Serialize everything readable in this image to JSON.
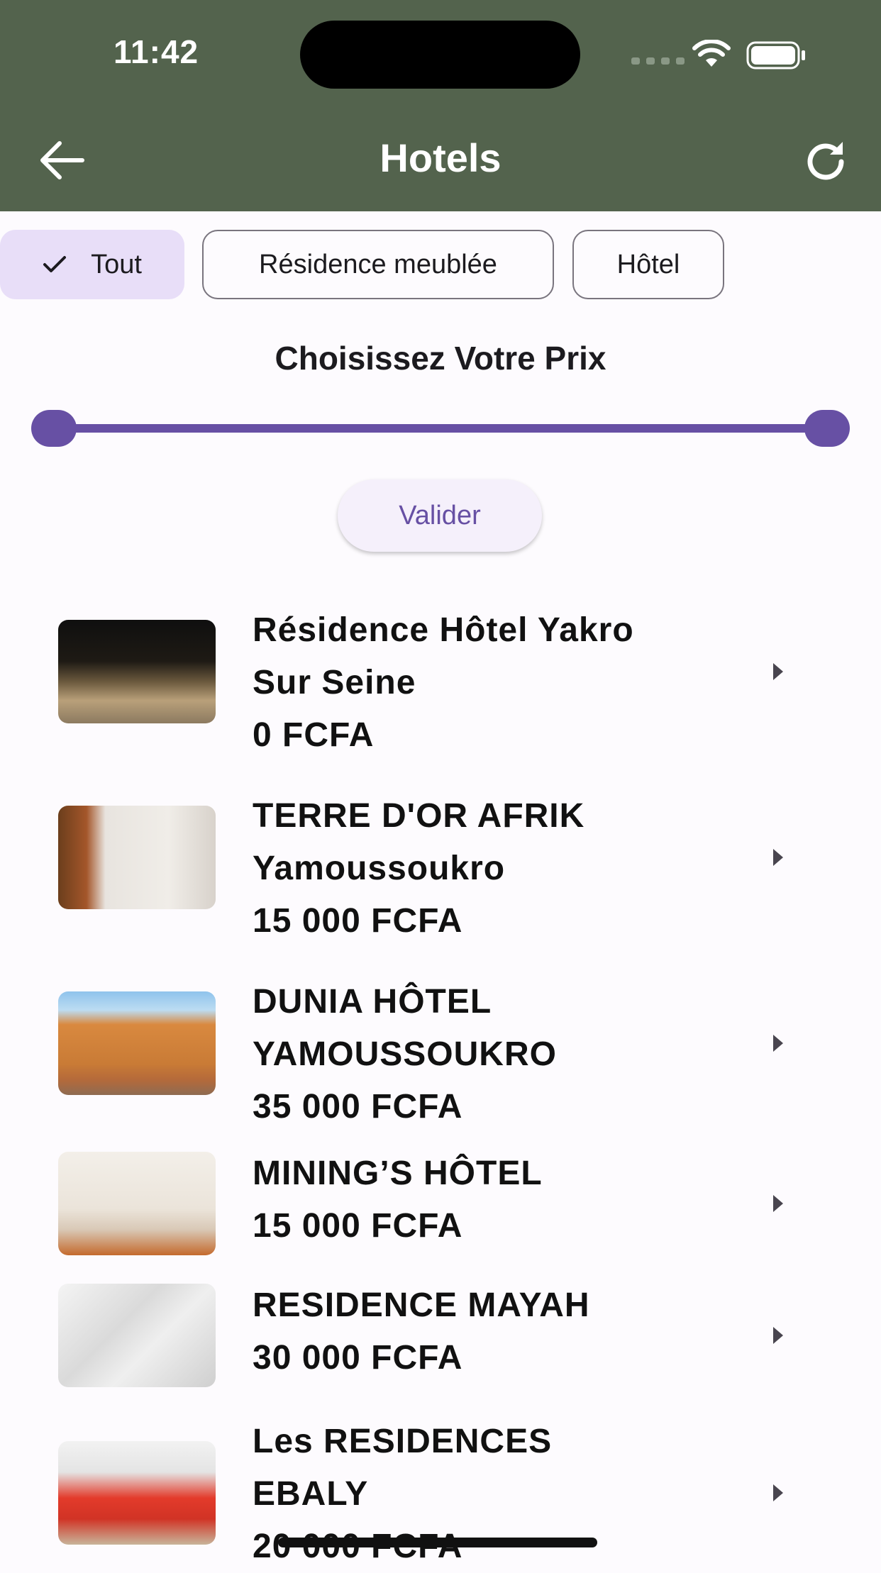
{
  "status_bar": {
    "time": "11:42"
  },
  "app_bar": {
    "title": "Hotels",
    "back_icon": "arrow-left-icon",
    "refresh_icon": "refresh-icon"
  },
  "filters": {
    "chips": [
      {
        "label": "Tout",
        "selected": true
      },
      {
        "label": "Résidence meublée",
        "selected": false
      },
      {
        "label": "Hôtel",
        "selected": false
      }
    ]
  },
  "price_filter": {
    "title": "Choisissez Votre Prix",
    "range_start_fraction": 0,
    "range_end_fraction": 1,
    "validate_label": "Valider"
  },
  "colors": {
    "app_bar": "#53634d",
    "accent": "#6750a4",
    "chip_selected": "#e8def8"
  },
  "hotels": [
    {
      "lines": [
        "Résidence Hôtel Yakro",
        "Sur Seine",
        "0 FCFA"
      ]
    },
    {
      "lines": [
        "TERRE D'OR AFRIK",
        "Yamoussoukro",
        "15 000 FCFA"
      ]
    },
    {
      "lines": [
        "DUNIA HÔTEL",
        "YAMOUSSOUKRO",
        "35 000 FCFA"
      ]
    },
    {
      "lines": [
        "MINING’S HÔTEL",
        "15 000 FCFA"
      ]
    },
    {
      "lines": [
        "RESIDENCE MAYAH",
        "30 000 FCFA"
      ]
    },
    {
      "lines": [
        "Les RESIDENCES",
        "EBALY",
        "20 000 FCFA"
      ]
    }
  ]
}
